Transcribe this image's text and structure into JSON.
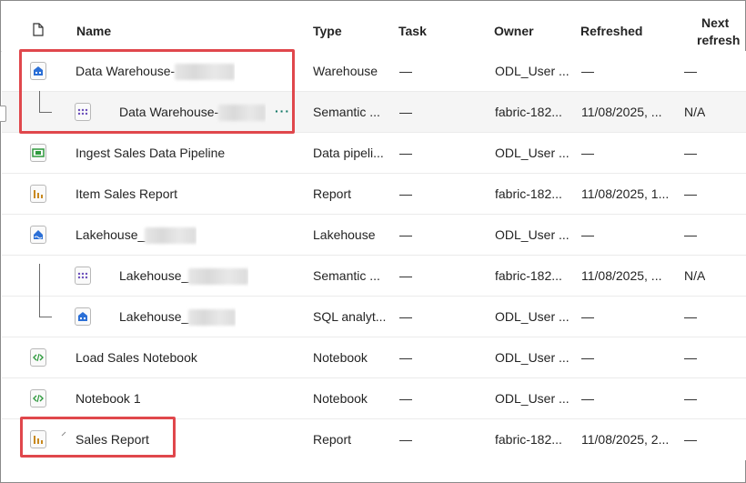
{
  "header": {
    "name": "Name",
    "type": "Type",
    "task": "Task",
    "owner": "Owner",
    "refreshed": "Refreshed",
    "next_refresh_line1": "Next",
    "next_refresh_line2": "refresh"
  },
  "rows": [
    {
      "name": "Data Warehouse-",
      "type": "Warehouse",
      "task": "—",
      "owner": "ODL_User ...",
      "refreshed": "—",
      "next": "—",
      "icon": "warehouse-icon"
    },
    {
      "name": "Data Warehouse-",
      "type": "Semantic ...",
      "task": "—",
      "owner": "fabric-182...",
      "refreshed": "11/08/2025, ...",
      "next": "N/A",
      "icon": "semantic-model-icon",
      "more": "···"
    },
    {
      "name": "Ingest Sales Data Pipeline",
      "type": "Data pipeli...",
      "task": "—",
      "owner": "ODL_User ...",
      "refreshed": "—",
      "next": "—",
      "icon": "pipeline-icon"
    },
    {
      "name": "Item Sales Report",
      "type": "Report",
      "task": "—",
      "owner": "fabric-182...",
      "refreshed": "11/08/2025, 1...",
      "next": "—",
      "icon": "report-icon"
    },
    {
      "name": "Lakehouse_",
      "type": "Lakehouse",
      "task": "—",
      "owner": "ODL_User ...",
      "refreshed": "—",
      "next": "—",
      "icon": "lakehouse-icon"
    },
    {
      "name": "Lakehouse_",
      "type": "Semantic ...",
      "task": "—",
      "owner": "fabric-182...",
      "refreshed": "11/08/2025, ...",
      "next": "N/A",
      "icon": "semantic-model-icon"
    },
    {
      "name": "Lakehouse_",
      "type": "SQL analyt...",
      "task": "—",
      "owner": "ODL_User ...",
      "refreshed": "—",
      "next": "—",
      "icon": "sql-endpoint-icon"
    },
    {
      "name": "Load Sales Notebook",
      "type": "Notebook",
      "task": "—",
      "owner": "ODL_User ...",
      "refreshed": "—",
      "next": "—",
      "icon": "notebook-icon"
    },
    {
      "name": "Notebook 1",
      "type": "Notebook",
      "task": "—",
      "owner": "ODL_User ...",
      "refreshed": "—",
      "next": "—",
      "icon": "notebook-icon"
    },
    {
      "name": "Sales Report",
      "type": "Report",
      "task": "—",
      "owner": "fabric-182...",
      "refreshed": "11/08/2025, 2...",
      "next": "—",
      "icon": "report-icon"
    }
  ],
  "colors": {
    "highlight": "#e0474c",
    "warehouse": "#2b6fd6",
    "semantic": "#6b4fbb",
    "pipeline": "#2f9a3e",
    "report": "#c8891f",
    "notebook": "#2f9a3e"
  }
}
